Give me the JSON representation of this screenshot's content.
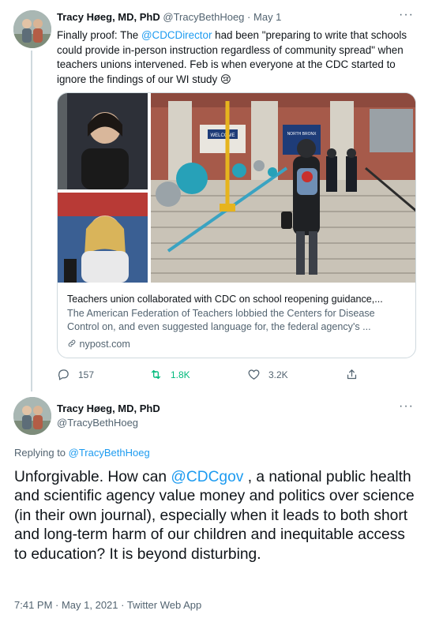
{
  "tweet1": {
    "name": "Tracy Høeg, MD, PhD",
    "handle": "@TracyBethHoeg",
    "separator": "·",
    "date": "May 1",
    "more": "···",
    "text_before": "Finally proof: The ",
    "mention": "@CDCDirector",
    "text_after": " had been \"preparing to write that schools could provide in-person instruction regardless of community spread\" when teachers unions intervened. Feb is when everyone at the CDC started to ignore the findings of our WI study 😢",
    "card": {
      "title": "Teachers union collaborated with CDC on school reopening guidance,...",
      "description": "The American Federation of Teachers lobbied the Centers for Disease Control on, and even suggested language for, the federal agency's ...",
      "domain": "nypost.com",
      "domain_icon": "link-icon",
      "sign_welcome": "WELCOME",
      "sign_school": "NORTH BRONX"
    },
    "actions": {
      "replies": "157",
      "retweets": "1.8K",
      "likes": "3.2K"
    }
  },
  "tweet2": {
    "name": "Tracy Høeg, MD, PhD",
    "handle": "@TracyBethHoeg",
    "more": "···",
    "replying_label": "Replying to ",
    "replying_handle": "@TracyBethHoeg",
    "text_before": "Unforgivable. How can ",
    "mention": "@CDCgov",
    "text_after": " , a national public health and scientific agency value money and politics over science (in their own journal), especially when it leads to both short and long-term harm of our children and inequitable access to education? It is beyond disturbing.",
    "timestamp": "7:41 PM · May 1, 2021 · Twitter Web App"
  },
  "colors": {
    "accent": "#1d9bf0",
    "retweet": "#00ba7c",
    "secondary_text": "#536471",
    "border": "#cfd9de"
  }
}
